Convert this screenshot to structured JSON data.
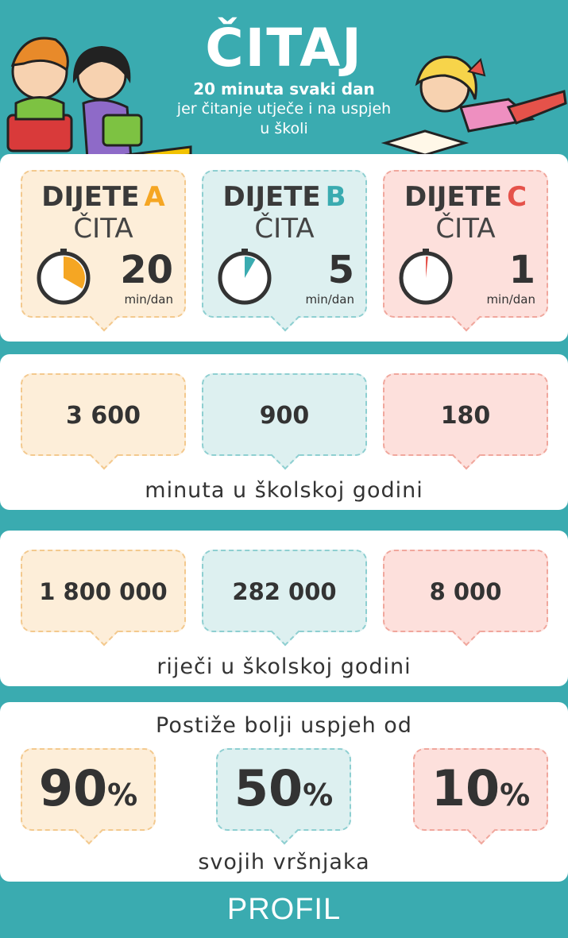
{
  "header": {
    "title": "ČITAJ",
    "subtitle_bold": "20 minuta svaki dan",
    "subtitle_rest": "jer čitanje utječe i na uspjeh u školi"
  },
  "children": [
    {
      "prefix": "DIJETE",
      "letter": "A",
      "reads": "ČITA",
      "minutes": "20",
      "unit": "min/dan",
      "color": "#f5a623",
      "clock_fraction": 0.333
    },
    {
      "prefix": "DIJETE",
      "letter": "B",
      "reads": "ČITA",
      "minutes": "5",
      "unit": "min/dan",
      "color": "#3aabb0",
      "clock_fraction": 0.083
    },
    {
      "prefix": "DIJETE",
      "letter": "C",
      "reads": "ČITA",
      "minutes": "1",
      "unit": "min/dan",
      "color": "#e5524a",
      "clock_fraction": 0.017
    }
  ],
  "minutes_row": {
    "values": [
      "3 600",
      "900",
      "180"
    ],
    "caption": "minuta u školskoj godini"
  },
  "words_row": {
    "values": [
      "1 800 000",
      "282 000",
      "8 000"
    ],
    "caption": "riječi u školskoj godini"
  },
  "success_row": {
    "intro": "Postiže bolji uspjeh od",
    "values": [
      "90",
      "50",
      "10"
    ],
    "percent_sign": "%",
    "caption": "svojih vršnjaka"
  },
  "footer": {
    "brand": "PROFIL"
  }
}
